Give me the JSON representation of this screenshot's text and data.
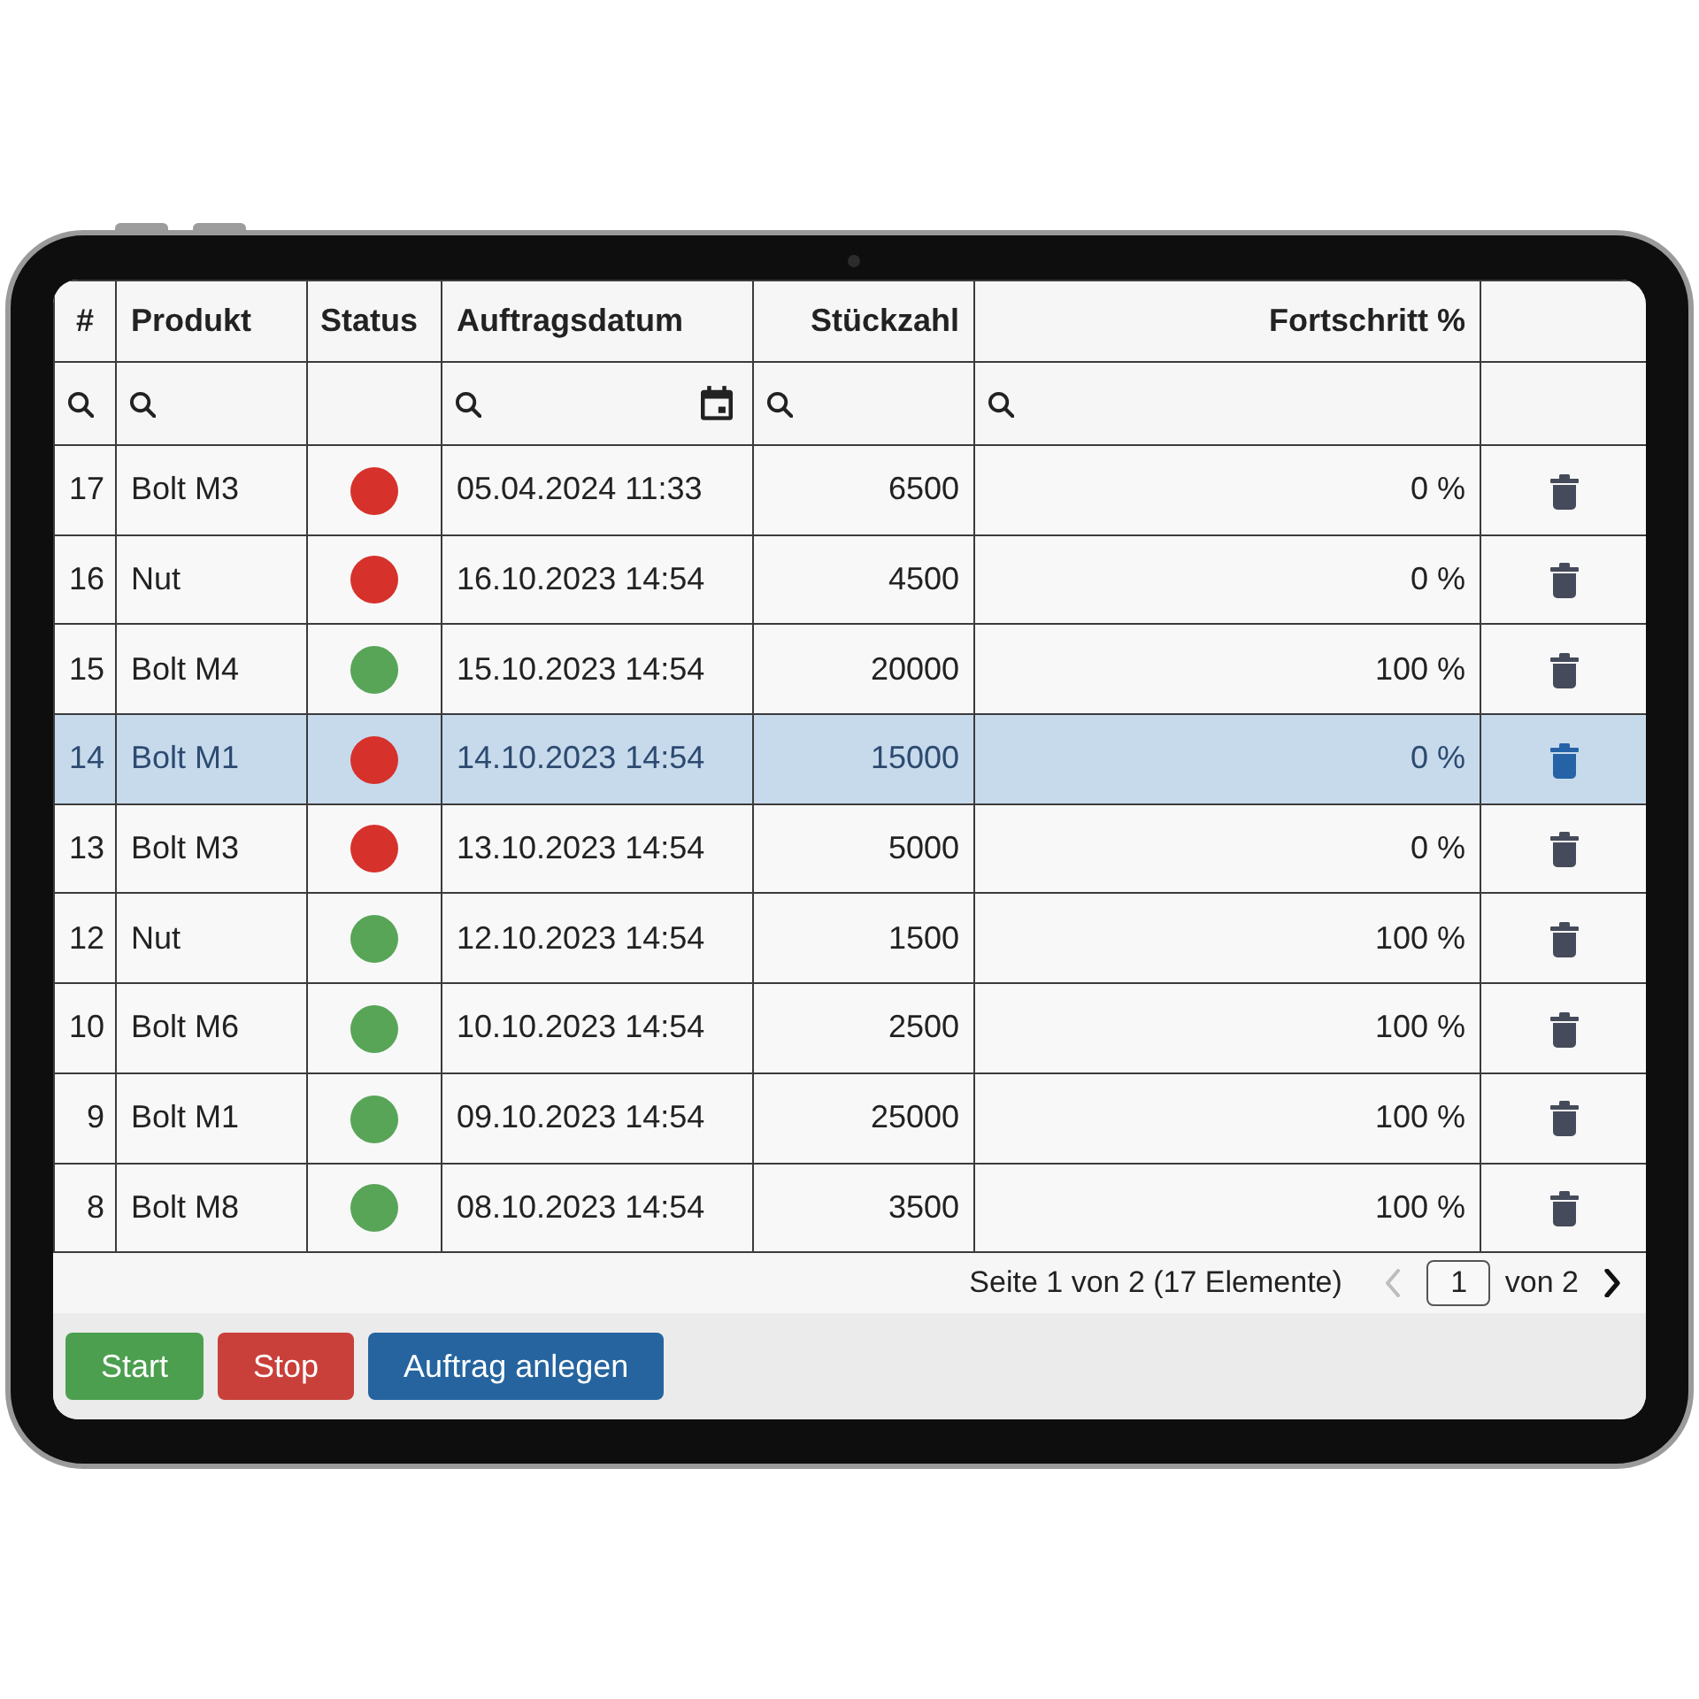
{
  "table": {
    "columns": [
      {
        "label": "#",
        "kind": "search"
      },
      {
        "label": "Produkt",
        "kind": "search"
      },
      {
        "label": "Status",
        "kind": "plain"
      },
      {
        "label": "Auftragsdatum",
        "kind": "date"
      },
      {
        "label": "Stückzahl",
        "kind": "search"
      },
      {
        "label": "Fortschritt %",
        "kind": "search"
      },
      {
        "kind": "plain"
      }
    ],
    "rows": [
      {
        "number": "17",
        "product": "Bolt M3",
        "color": "#d7312b",
        "ordered": "05.04.2024 11:33",
        "quantity": "6500",
        "progress": "0 %",
        "selected": false
      },
      {
        "number": "16",
        "product": "Nut",
        "color": "#d7312b",
        "ordered": "16.10.2023 14:54",
        "quantity": "4500",
        "progress": "0 %",
        "selected": false
      },
      {
        "number": "15",
        "product": "Bolt M4",
        "color": "#58a558",
        "ordered": "15.10.2023 14:54",
        "quantity": "20000",
        "progress": "100 %",
        "selected": false
      },
      {
        "number": "14",
        "product": "Bolt M1",
        "color": "#d7312b",
        "ordered": "14.10.2023 14:54",
        "quantity": "15000",
        "progress": "0 %",
        "selected": true
      },
      {
        "number": "13",
        "product": "Bolt M3",
        "color": "#d7312b",
        "ordered": "13.10.2023 14:54",
        "quantity": "5000",
        "progress": "0 %",
        "selected": false
      },
      {
        "number": "12",
        "product": "Nut",
        "color": "#58a558",
        "ordered": "12.10.2023 14:54",
        "quantity": "1500",
        "progress": "100 %",
        "selected": false
      },
      {
        "number": "10",
        "product": "Bolt M6",
        "color": "#58a558",
        "ordered": "10.10.2023 14:54",
        "quantity": "2500",
        "progress": "100 %",
        "selected": false
      },
      {
        "number": "9",
        "product": "Bolt M1",
        "color": "#58a558",
        "ordered": "09.10.2023 14:54",
        "quantity": "25000",
        "progress": "100 %",
        "selected": false
      },
      {
        "number": "8",
        "product": "Bolt M8",
        "color": "#58a558",
        "ordered": "08.10.2023 14:54",
        "quantity": "3500",
        "progress": "100 %",
        "selected": false
      }
    ]
  },
  "pager": {
    "summary": "Seite 1 von 2 (17 Elemente)",
    "previous_disabled": true,
    "page": "1",
    "total": "von 2",
    "next_disabled": false
  },
  "buttons": [
    {
      "label": "Start",
      "color": "#4c9f4f"
    },
    {
      "label": "Stop",
      "color": "#c9403a"
    },
    {
      "label": "Auftrag anlegen",
      "color": "#25649f"
    }
  ]
}
